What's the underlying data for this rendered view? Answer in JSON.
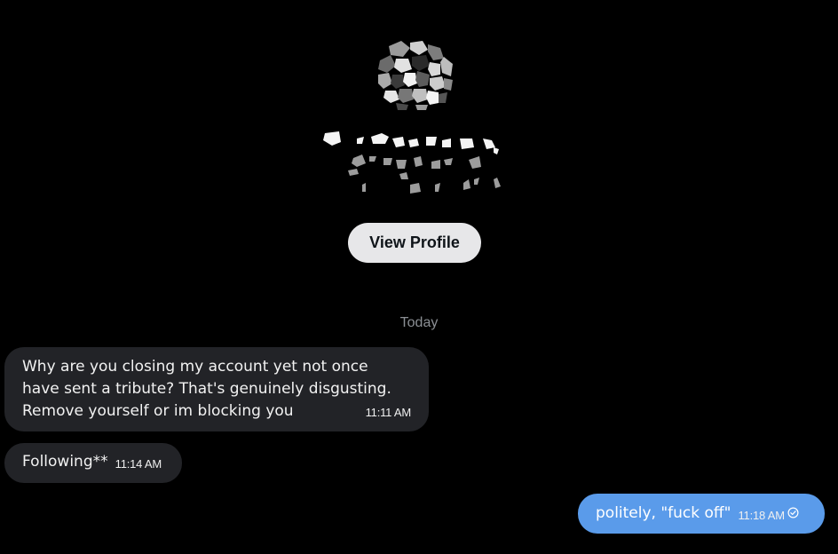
{
  "header": {
    "view_profile_label": "View Profile"
  },
  "date_separator": "Today",
  "messages": [
    {
      "direction": "incoming",
      "text": "Why are you closing my account yet not once have sent a tribute? That's genuinely disgusting. Remove yourself or im blocking you",
      "time": "11:11 AM"
    },
    {
      "direction": "incoming",
      "text": "Following**",
      "time": "11:14 AM"
    },
    {
      "direction": "outgoing",
      "text": "politely, \"fuck off\"",
      "time": "11:18 AM",
      "status_icon": "sent-check-icon"
    }
  ],
  "colors": {
    "background": "#000000",
    "incoming_bubble": "#222327",
    "outgoing_bubble": "#5a9bea",
    "view_profile_button": "#e7e7e9",
    "date_separator": "#8b8f94"
  }
}
